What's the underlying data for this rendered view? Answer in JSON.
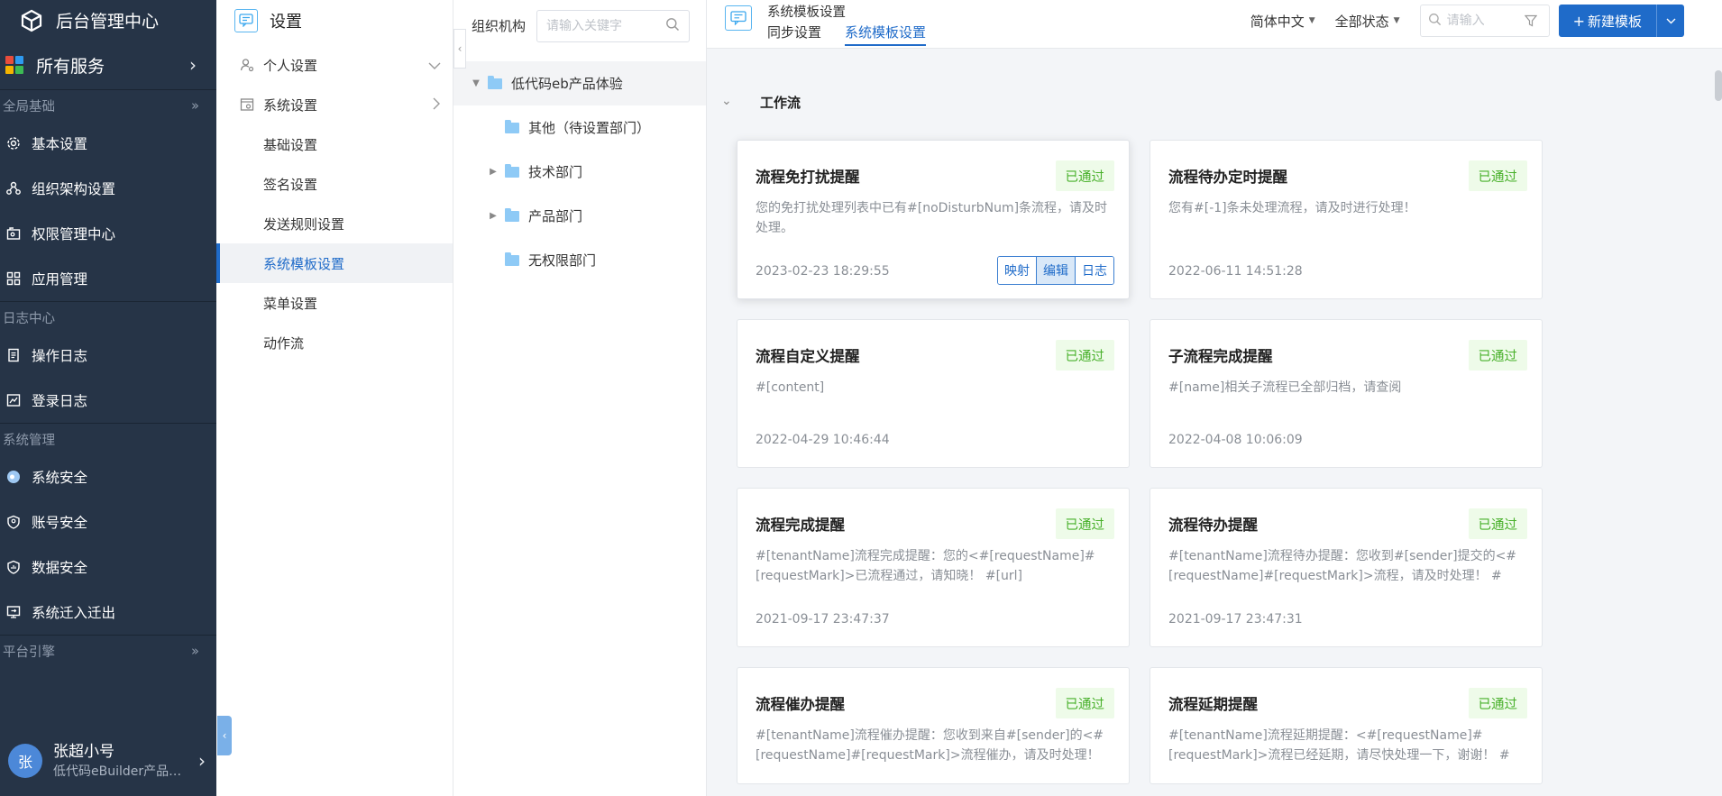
{
  "app": {
    "title": "后台管理中心"
  },
  "nav": {
    "all_services": "所有服务",
    "groups": [
      {
        "label": "全局基础",
        "items": [
          "基本设置",
          "组织架构设置",
          "权限管理中心",
          "应用管理"
        ]
      },
      {
        "label": "日志中心",
        "items": [
          "操作日志",
          "登录日志"
        ]
      },
      {
        "label": "系统管理",
        "items": [
          "系统安全",
          "账号安全",
          "数据安全",
          "系统迁入迁出"
        ]
      },
      {
        "label": "平台引擎",
        "items": []
      }
    ],
    "user": {
      "avatar": "张",
      "name": "张超小号",
      "tenant": "低代码eBuilder产品体验"
    }
  },
  "settings": {
    "title": "设置",
    "personal": "个人设置",
    "system": "系统设置",
    "sub": [
      "基础设置",
      "签名设置",
      "发送规则设置",
      "系统模板设置",
      "菜单设置",
      "动作流"
    ],
    "active_index": 3
  },
  "org": {
    "label": "组织机构",
    "search_placeholder": "请输入关键字",
    "root": "低代码eb产品体验",
    "children": [
      "其他（待设置部门）",
      "技术部门",
      "产品部门",
      "无权限部门"
    ]
  },
  "topbar": {
    "title": "系统模板设置",
    "tabs": [
      "同步设置",
      "系统模板设置"
    ],
    "active_tab": 1,
    "language": "简体中文",
    "status": "全部状态",
    "search_placeholder": "请输入",
    "new_button": "新建模板"
  },
  "section": {
    "title": "工作流"
  },
  "cards": [
    {
      "title": "流程免打扰提醒",
      "status": "已通过",
      "desc": "您的免打扰处理列表中已有#[noDisturbNum]条流程，请及时处理。",
      "date": "2023-02-23 18:29:55",
      "actions": [
        "映射",
        "编辑",
        "日志"
      ]
    },
    {
      "title": "流程待办定时提醒",
      "status": "已通过",
      "desc": "您有#[-1]条未处理流程，请及时进行处理！",
      "date": "2022-06-11 14:51:28"
    },
    {
      "title": "流程自定义提醒",
      "status": "已通过",
      "desc": "#[content]",
      "date": "2022-04-29 10:46:44"
    },
    {
      "title": "子流程完成提醒",
      "status": "已通过",
      "desc": "#[name]相关子流程已全部归档，请查阅",
      "date": "2022-04-08 10:06:09"
    },
    {
      "title": "流程完成提醒",
      "status": "已通过",
      "desc": "#[tenantName]流程完成提醒：您的<#[requestName]#[requestMark]>已流程通过，请知晓！ #[url]",
      "date": "2021-09-17 23:47:37"
    },
    {
      "title": "流程待办提醒",
      "status": "已通过",
      "desc": "#[tenantName]流程待办提醒：您收到#[sender]提交的<#[requestName]#[requestMark]>流程，请及时处理！ #[url]",
      "date": "2021-09-17 23:47:31"
    },
    {
      "title": "流程催办提醒",
      "status": "已通过",
      "desc": "#[tenantName]流程催办提醒：您收到来自#[sender]的<#[requestName]#[requestMark]>流程催办，请及时处理！ #",
      "date": ""
    },
    {
      "title": "流程延期提醒",
      "status": "已通过",
      "desc": "#[tenantName]流程延期提醒：<#[requestName]#[requestMark]>流程已经延期，请尽快处理一下，谢谢！ #",
      "date": ""
    }
  ],
  "colors": {
    "nav_bg": "#263447",
    "accent": "#1f6bc9",
    "badge_bg": "#eefbe9",
    "badge_text": "#48b02a"
  }
}
